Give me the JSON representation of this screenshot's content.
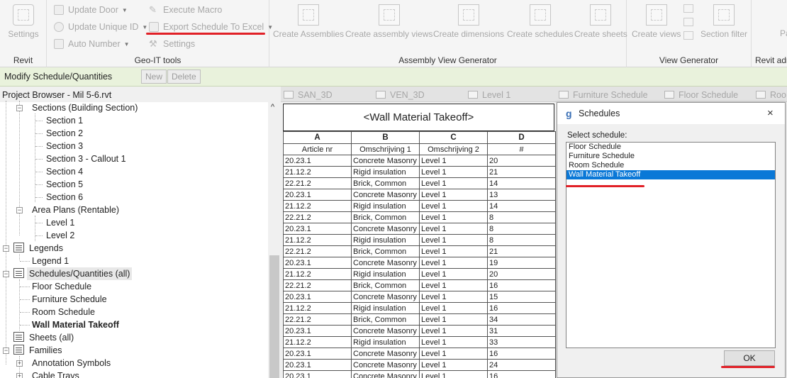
{
  "ribbon": {
    "revit_panel": {
      "settings": "Settings",
      "label": "Revit"
    },
    "geoit_panel": {
      "update_door": "Update Door",
      "update_unique_id": "Update Unique ID",
      "auto_number": "Auto Number",
      "execute_macro": "Execute Macro",
      "export_schedule": "Export Schedule To Excel",
      "settings": "Settings",
      "label": "Geo-IT tools"
    },
    "assembly_panel": {
      "create_assemblies": "Create Assemblies",
      "create_assembly_views": "Create assembly views",
      "create_dimensions": "Create dimensions",
      "create_schedules": "Create schedules",
      "create_sheets": "Create sheets",
      "label": "Assembly View Generator"
    },
    "view_gen_panel": {
      "create_views": "Create views",
      "section_filter": "Section filter",
      "label": "View Generator"
    },
    "cut_panel": {
      "btn": "Pa",
      "label": "Revit adr"
    }
  },
  "context_bar": {
    "title": "Modify Schedule/Quantities",
    "new": "New",
    "delete": "Delete"
  },
  "project_browser": {
    "title": "Project Browser - Mil 5-6.rvt",
    "nodes": [
      {
        "label": "Sections (Building Section)"
      },
      {
        "label": "Section 1"
      },
      {
        "label": "Section 2"
      },
      {
        "label": "Section 3"
      },
      {
        "label": "Section 3 - Callout 1"
      },
      {
        "label": "Section 4"
      },
      {
        "label": "Section 5"
      },
      {
        "label": "Section 6"
      },
      {
        "label": "Area Plans (Rentable)"
      },
      {
        "label": "Level 1"
      },
      {
        "label": "Level 2"
      },
      {
        "label": "Legends"
      },
      {
        "label": "Legend 1"
      },
      {
        "label": "Schedules/Quantities (all)"
      },
      {
        "label": "Floor Schedule"
      },
      {
        "label": "Furniture Schedule"
      },
      {
        "label": "Room Schedule"
      },
      {
        "label": "Wall Material Takeoff"
      },
      {
        "label": "Sheets (all)"
      },
      {
        "label": "Families"
      },
      {
        "label": "Annotation Symbols"
      },
      {
        "label": "Cable Trays"
      }
    ]
  },
  "view_tabs": [
    "SAN_3D",
    "VEN_3D",
    "Level 1",
    "Furniture Schedule",
    "Floor Schedule",
    "Roo"
  ],
  "schedule": {
    "title": "<Wall Material Takeoff>",
    "column_letters": [
      "A",
      "B",
      "C",
      "D"
    ],
    "column_headers": [
      "Article nr",
      "Omschrijving 1",
      "Omschrijving 2",
      "#"
    ],
    "rows": [
      [
        "20.23.1",
        "Concrete Masonry",
        "Level 1",
        "20"
      ],
      [
        "21.12.2",
        "Rigid insulation",
        "Level 1",
        "21"
      ],
      [
        "22.21.2",
        "Brick, Common",
        "Level 1",
        "14"
      ],
      [
        "20.23.1",
        "Concrete Masonry",
        "Level 1",
        "13"
      ],
      [
        "21.12.2",
        "Rigid insulation",
        "Level 1",
        "14"
      ],
      [
        "22.21.2",
        "Brick, Common",
        "Level 1",
        "8"
      ],
      [
        "20.23.1",
        "Concrete Masonry",
        "Level 1",
        "8"
      ],
      [
        "21.12.2",
        "Rigid insulation",
        "Level 1",
        "8"
      ],
      [
        "22.21.2",
        "Brick, Common",
        "Level 1",
        "21"
      ],
      [
        "20.23.1",
        "Concrete Masonry",
        "Level 1",
        "19"
      ],
      [
        "21.12.2",
        "Rigid insulation",
        "Level 1",
        "20"
      ],
      [
        "22.21.2",
        "Brick, Common",
        "Level 1",
        "16"
      ],
      [
        "20.23.1",
        "Concrete Masonry",
        "Level 1",
        "15"
      ],
      [
        "21.12.2",
        "Rigid insulation",
        "Level 1",
        "16"
      ],
      [
        "22.21.2",
        "Brick, Common",
        "Level 1",
        "34"
      ],
      [
        "20.23.1",
        "Concrete Masonry",
        "Level 1",
        "31"
      ],
      [
        "21.12.2",
        "Rigid insulation",
        "Level 1",
        "33"
      ],
      [
        "20.23.1",
        "Concrete Masonry",
        "Level 1",
        "16"
      ],
      [
        "20.23.1",
        "Concrete Masonry",
        "Level 1",
        "24"
      ],
      [
        "20.23.1",
        "Concrete Masonry",
        "Level 1",
        "16"
      ]
    ]
  },
  "dialog": {
    "title": "Schedules",
    "logo": "g",
    "close": "×",
    "select_label": "Select schedule:",
    "options": [
      "Floor Schedule",
      "Furniture Schedule",
      "Room Schedule",
      "Wall Material Takeoff"
    ],
    "selected_index": 3,
    "ok": "OK"
  },
  "colors": {
    "highlight_red": "#e12027",
    "selection_blue": "#0a78d7",
    "context_green": "#e9f2dc"
  }
}
